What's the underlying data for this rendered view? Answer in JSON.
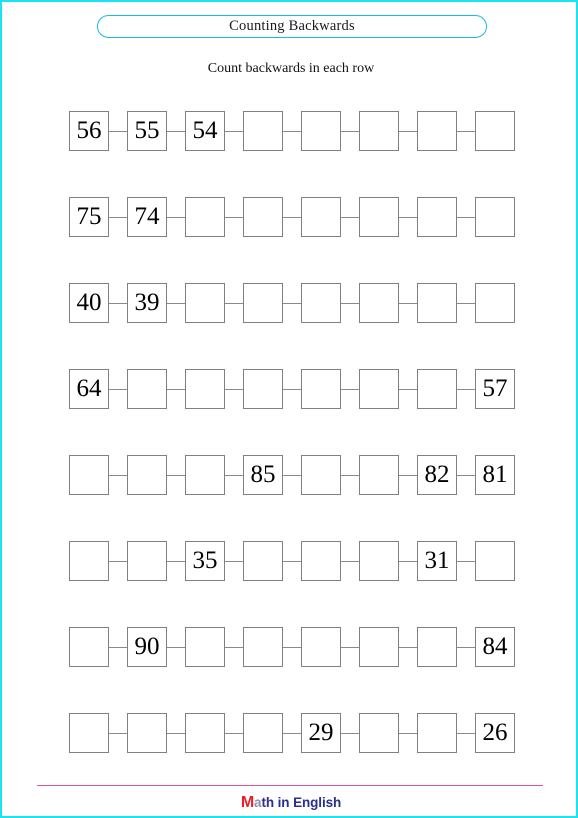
{
  "page": {
    "border_color": "#19e5f0",
    "background": "#ffffff"
  },
  "header": {
    "title": "Counting Backwards",
    "title_border_color": "#1bbbe0",
    "subtitle": "Count backwards in each row"
  },
  "worksheet": {
    "cell_border_color": "#808080",
    "columns": 8,
    "rows": [
      {
        "id": "row-1",
        "cells": [
          "56",
          "55",
          "54",
          "",
          "",
          "",
          "",
          ""
        ]
      },
      {
        "id": "row-2",
        "cells": [
          "75",
          "74",
          "",
          "",
          "",
          "",
          "",
          ""
        ]
      },
      {
        "id": "row-3",
        "cells": [
          "40",
          "39",
          "",
          "",
          "",
          "",
          "",
          ""
        ]
      },
      {
        "id": "row-4",
        "cells": [
          "64",
          "",
          "",
          "",
          "",
          "",
          "",
          "57"
        ]
      },
      {
        "id": "row-5",
        "cells": [
          "",
          "",
          "",
          "85",
          "",
          "",
          "82",
          "81"
        ]
      },
      {
        "id": "row-6",
        "cells": [
          "",
          "",
          "35",
          "",
          "",
          "",
          "31",
          ""
        ]
      },
      {
        "id": "row-7",
        "cells": [
          "",
          "90",
          "",
          "",
          "",
          "",
          "",
          "84"
        ]
      },
      {
        "id": "row-8",
        "cells": [
          "",
          "",
          "",
          "",
          "29",
          "",
          "",
          "26"
        ]
      }
    ]
  },
  "footer": {
    "rule_color": "#e0559a",
    "brand_lead": "M",
    "brand_faded": "a",
    "brand_rest": "th in English",
    "brand_full": "Math in English",
    "lead_color": "#ee1c25",
    "text_color": "#2b2f8f"
  }
}
